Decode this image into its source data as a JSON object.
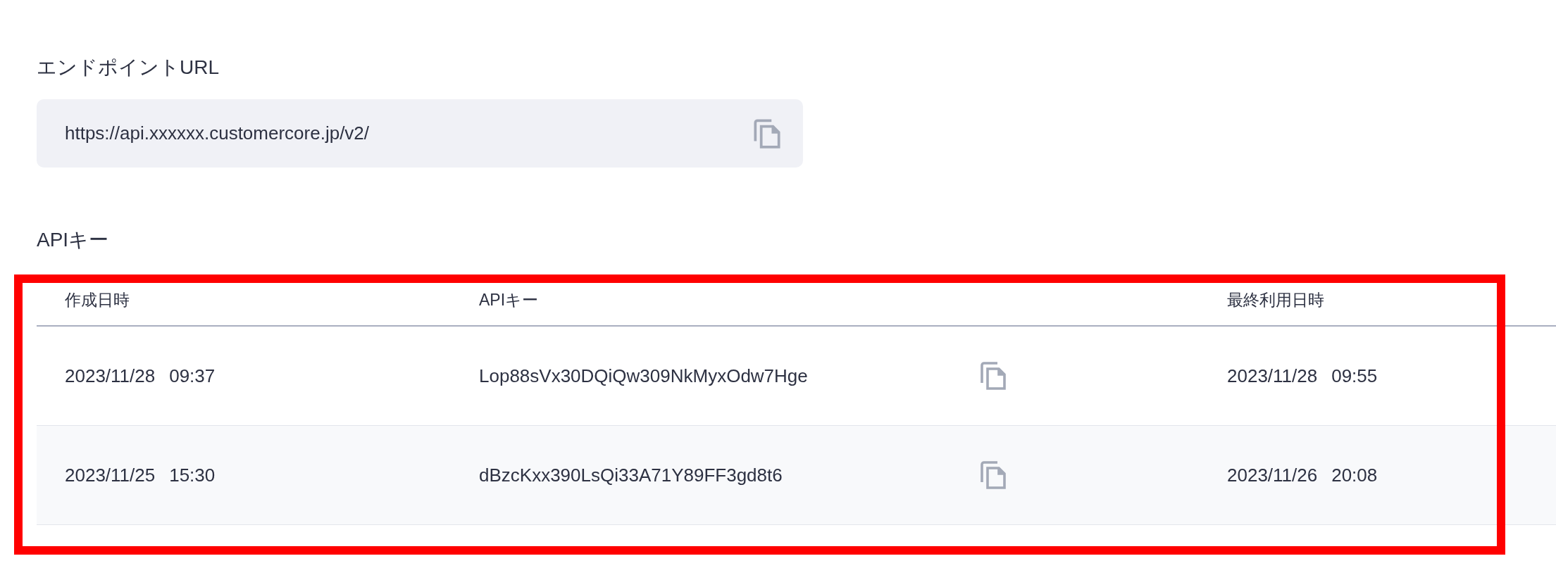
{
  "endpoint": {
    "label": "エンドポイントURL",
    "value": "https://api.xxxxxx.customercore.jp/v2/"
  },
  "api_keys": {
    "label": "APIキー",
    "columns": [
      "作成日時",
      "APIキー",
      "最終利用日時"
    ],
    "rows": [
      {
        "created": "2023/11/28",
        "created_time": "09:37",
        "key": "Lop88sVx30DQiQw309NkMyxOdw7Hge",
        "last_used": "2023/11/28",
        "last_used_time": "09:55"
      },
      {
        "created": "2023/11/25",
        "created_time": "15:30",
        "key": "dBzcKxx390LsQi33A71Y89FF3gd8t6",
        "last_used": "2023/11/26",
        "last_used_time": "20:08"
      }
    ]
  }
}
